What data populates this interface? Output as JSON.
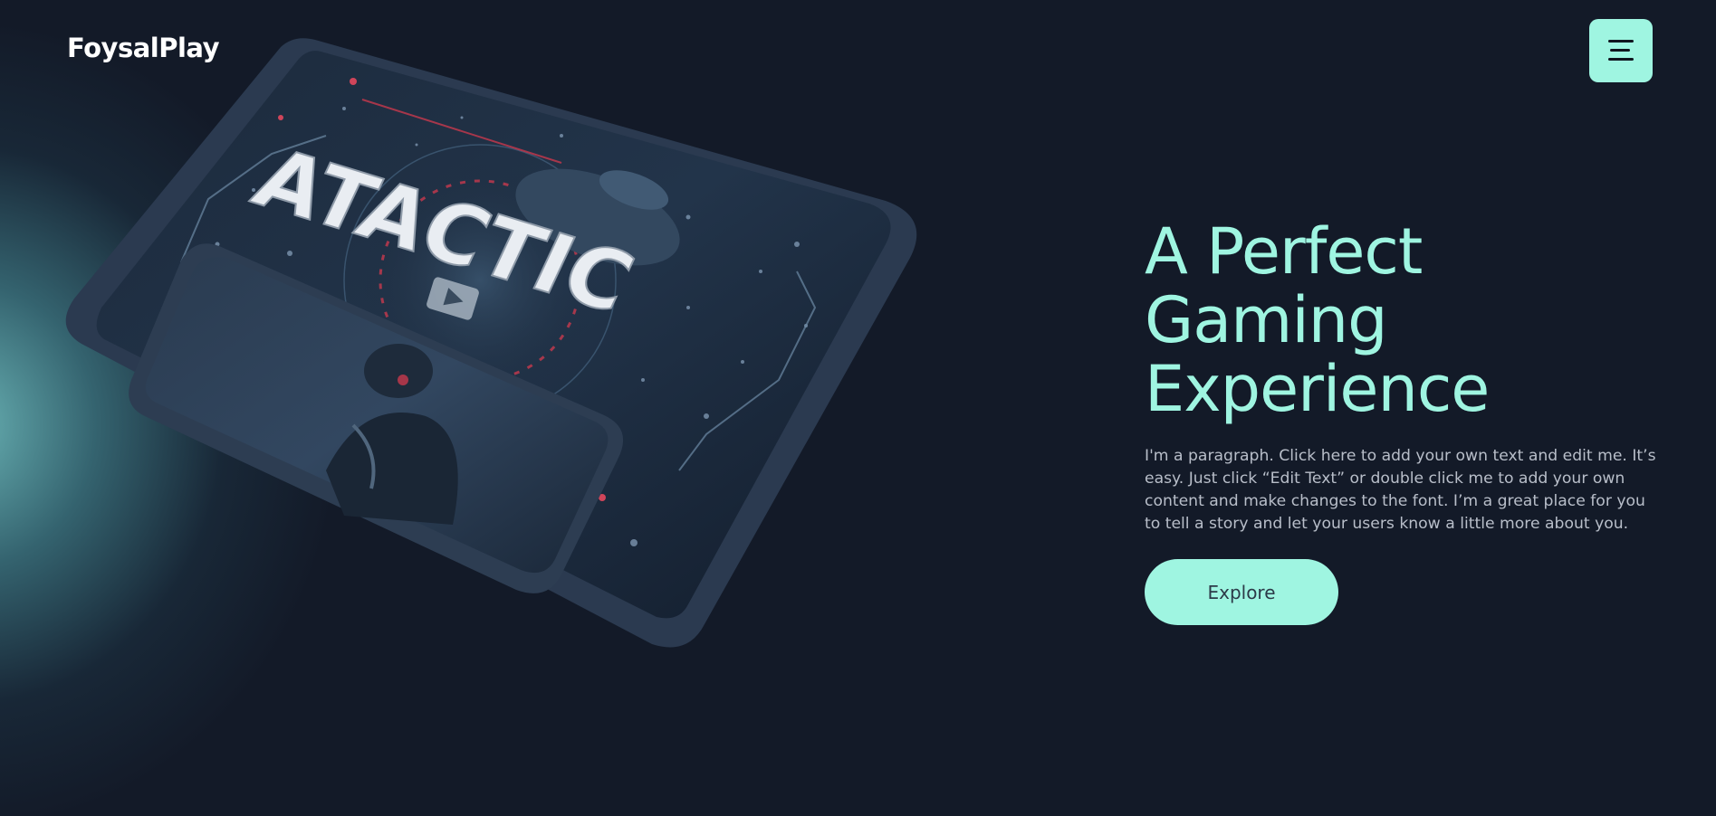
{
  "header": {
    "brand": "FoysalPlay",
    "menu_icon": "hamburger-menu-icon"
  },
  "hero_image": {
    "game_title": "ATACTIC",
    "play_icon": "play-icon"
  },
  "hero": {
    "headline_lines": [
      "A Perfect",
      "Gaming",
      "Experience"
    ],
    "paragraph": "I'm a paragraph. Click here to add your own text and edit me. It’s easy. Just click “Edit Text” or double click me to add your own content and make changes to the font. I’m a great place for you to tell a story and let your users know a little more about you.",
    "cta_label": "Explore"
  },
  "colors": {
    "background": "#131a28",
    "accent": "#9ff5e1",
    "paragraph": "#b8bec9",
    "glow": "#78cdcd"
  }
}
